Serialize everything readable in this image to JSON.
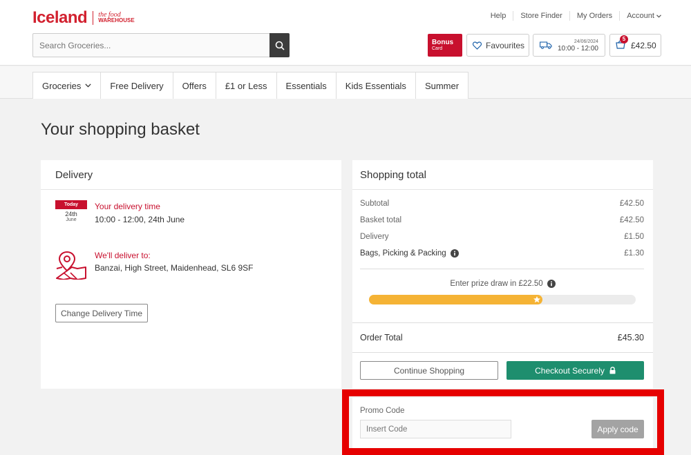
{
  "header": {
    "logo_primary": "Iceland",
    "logo_secondary_line1": "the food",
    "logo_secondary_line2": "WAREHOUSE",
    "top_links": [
      "Help",
      "Store Finder",
      "My Orders",
      "Account"
    ],
    "search_placeholder": "Search Groceries...",
    "bonus_label": "Bonus",
    "bonus_sub": "Card",
    "favourites_label": "Favourites",
    "slot_date": "24/06/2024",
    "slot_time": "10:00 - 12:00",
    "basket_count": "5",
    "basket_total": "£42.50"
  },
  "nav": {
    "items": [
      "Groceries",
      "Free Delivery",
      "Offers",
      "£1 or Less",
      "Essentials",
      "Kids Essentials",
      "Summer"
    ]
  },
  "page": {
    "title": "Your shopping basket"
  },
  "delivery": {
    "heading": "Delivery",
    "calendar_top": "Today",
    "calendar_day": "24th",
    "calendar_month": "June",
    "time_label": "Your delivery time",
    "time_value": "10:00 - 12:00, 24th June",
    "address_label": "We'll deliver to:",
    "address_value": "Banzai, High Street, Maidenhead, SL6 9SF",
    "change_button": "Change Delivery Time"
  },
  "totals": {
    "heading": "Shopping total",
    "rows": [
      {
        "label": "Subtotal",
        "value": "£42.50"
      },
      {
        "label": "Basket total",
        "value": "£42.50"
      },
      {
        "label": "Delivery",
        "value": "£1.50"
      },
      {
        "label": "Bags, Picking & Packing",
        "value": "£1.30"
      }
    ],
    "prize_text": "Enter prize draw in £22.50",
    "prize_progress": 0.65,
    "order_total_label": "Order Total",
    "order_total_value": "£45.30",
    "continue_button": "Continue Shopping",
    "checkout_button": "Checkout Securely"
  },
  "promo": {
    "label": "Promo Code",
    "placeholder": "Insert Code",
    "apply_button": "Apply code"
  },
  "colors": {
    "brand": "#c8102e",
    "checkout": "#1e8e6e",
    "progress": "#f5b335",
    "highlight": "#e60000"
  }
}
